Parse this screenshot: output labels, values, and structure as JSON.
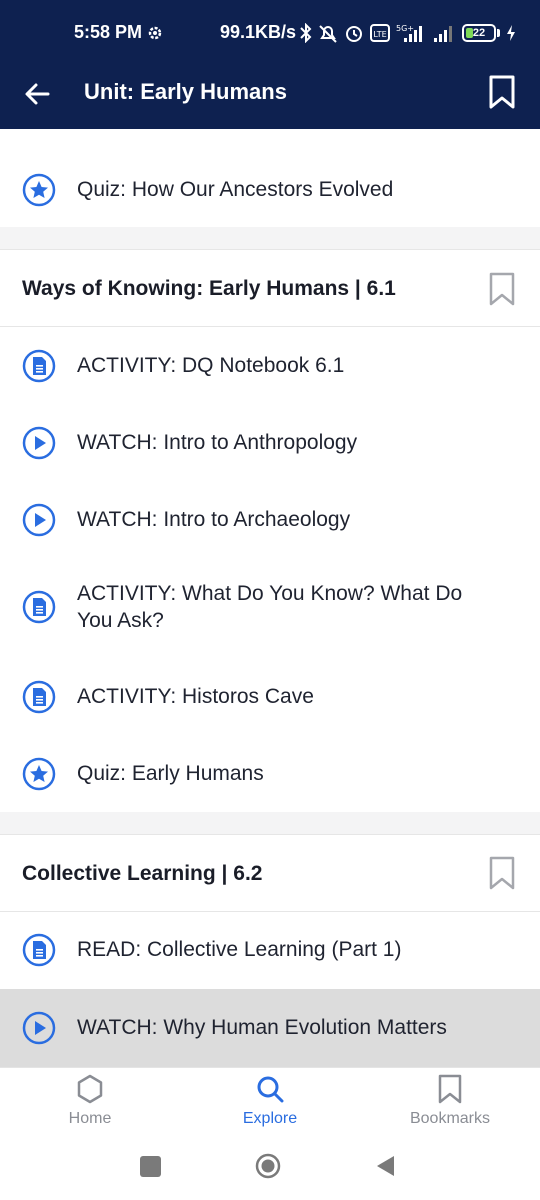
{
  "status_bar": {
    "time": "5:58 PM",
    "speed": "99.1KB/s",
    "battery": "22",
    "network": "5G+"
  },
  "app_bar": {
    "title": "Unit: Early Humans"
  },
  "items": [
    {
      "label": "Quiz: How Our Ancestors Evolved",
      "icon": "star-icon"
    },
    {
      "label": "Ways of Knowing: Early Humans | 6.1",
      "type": "section"
    },
    {
      "label": "ACTIVITY: DQ Notebook 6.1",
      "icon": "document-icon"
    },
    {
      "label": "WATCH: Intro to Anthropology",
      "icon": "play-icon"
    },
    {
      "label": "WATCH: Intro to Archaeology",
      "icon": "play-icon"
    },
    {
      "label": "ACTIVITY: What Do You Know? What Do You Ask?",
      "icon": "document-icon"
    },
    {
      "label": "ACTIVITY: Historos Cave",
      "icon": "document-icon"
    },
    {
      "label": "Quiz: Early Humans",
      "icon": "star-icon"
    },
    {
      "label": "Collective Learning | 6.2",
      "type": "section"
    },
    {
      "label": "READ: Collective Learning (Part 1)",
      "icon": "document-icon"
    },
    {
      "label": "WATCH: Why Human Evolution Matters",
      "icon": "play-icon",
      "highlighted": true
    }
  ],
  "bottom_nav": [
    {
      "label": "Home",
      "icon": "hexagon-home-icon"
    },
    {
      "label": "Explore",
      "icon": "search-icon",
      "active": true
    },
    {
      "label": "Bookmarks",
      "icon": "bookmark-icon"
    }
  ],
  "colors": {
    "header_bg": "#0e2150",
    "accent": "#2a6de0",
    "highlight_row": "#dcdcdc"
  }
}
